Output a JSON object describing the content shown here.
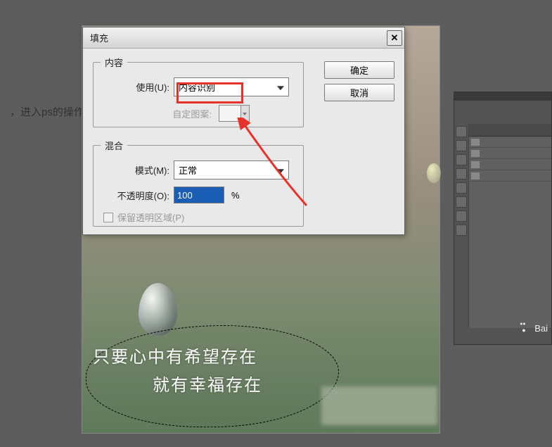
{
  "page_text": "，进入ps的操作",
  "dialog": {
    "title": "填充",
    "close_glyph": "✕",
    "content_legend": "内容",
    "use_label": "使用(U):",
    "use_value": "内容识别",
    "pattern_label": "自定图案:",
    "blend_legend": "混合",
    "mode_label": "模式(M):",
    "mode_value": "正常",
    "opacity_label": "不透明度(O):",
    "opacity_value": "100",
    "opacity_unit": "%",
    "preserve_label": "保留透明区域(P)",
    "ok_label": "确定",
    "cancel_label": "取消"
  },
  "watermark": {
    "line1": "只要心中有希望存在",
    "line2": "就有幸福存在"
  },
  "side_brand": "Bai",
  "colors": {
    "highlight": "#e73229",
    "arrow": "#e73229"
  }
}
